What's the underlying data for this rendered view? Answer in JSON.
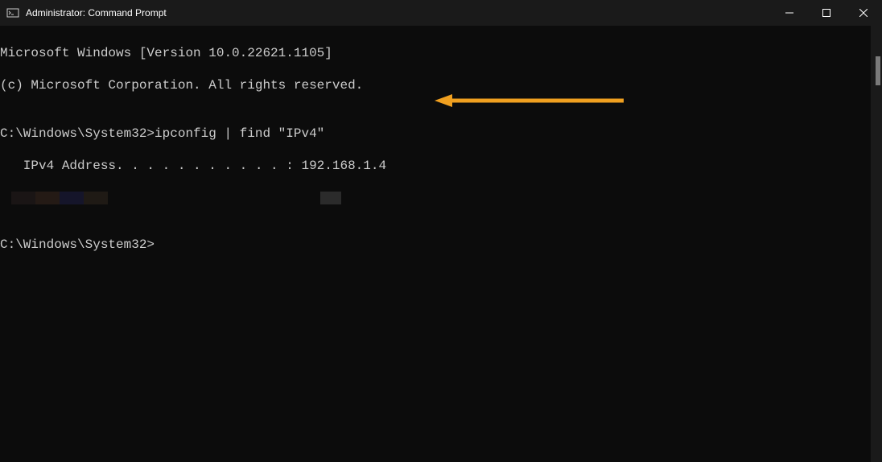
{
  "titlebar": {
    "title": "Administrator: Command Prompt"
  },
  "console": {
    "line1": "Microsoft Windows [Version 10.0.22621.1105]",
    "line2": "(c) Microsoft Corporation. All rights reserved.",
    "blank1": "",
    "prompt_line": "C:\\Windows\\System32>ipconfig | find \"IPv4\"",
    "output_line": "   IPv4 Address. . . . . . . . . . . : 192.168.1.4",
    "blank2": "",
    "prompt2": "C:\\Windows\\System32>"
  },
  "annotation": {
    "arrow_color": "#f0a020"
  }
}
